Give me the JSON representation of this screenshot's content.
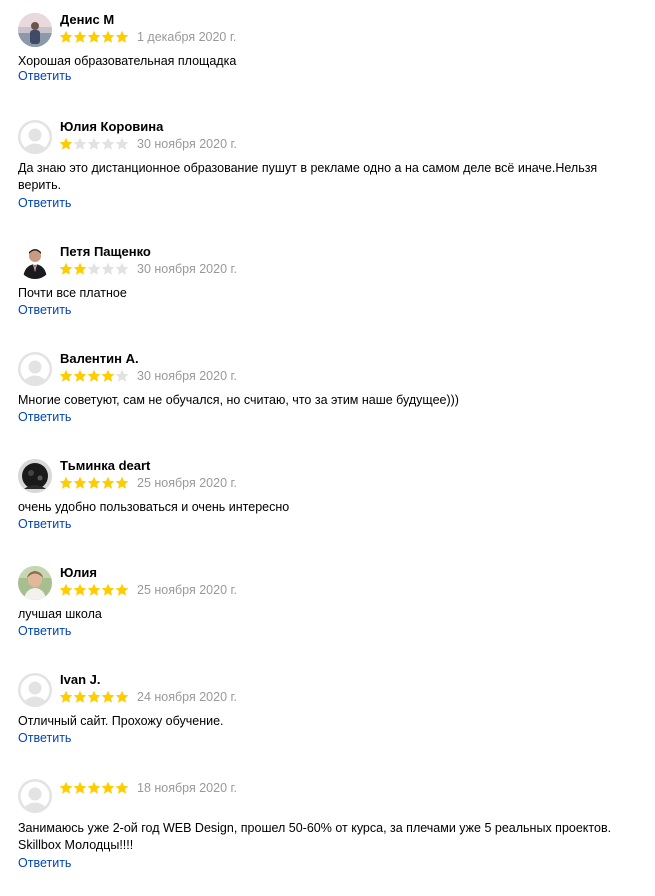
{
  "reply_label": "Ответить",
  "colors": {
    "star_filled": "#ffcc00",
    "star_empty": "#e2e2e2",
    "link": "#0044bb",
    "date": "#999999"
  },
  "reviews": [
    {
      "author": "Денис М",
      "rating": 5,
      "date": "1 декабря 2020 г.",
      "text": "Хорошая образовательная площадка",
      "avatar": "photo-person-outdoors"
    },
    {
      "author": "Юлия Коровина",
      "rating": 1,
      "date": "30 ноября 2020 г.",
      "text": "Да знаю это дистанционное образование пушут в рекламе одно а на самом деле всё иначе.Нельзя верить.",
      "avatar": "default-user-icon"
    },
    {
      "author": "Петя Пащенко",
      "rating": 2,
      "date": "30 ноября 2020 г.",
      "text": "Почти все платное",
      "avatar": "photo-person-suit"
    },
    {
      "author": "Валентин А.",
      "rating": 4,
      "date": "30 ноября 2020 г.",
      "text": "Многие советуют, сам не обучался, но считаю, что за этим наше будущее)))",
      "avatar": "default-user-icon"
    },
    {
      "author": "Тьминка deart",
      "rating": 5,
      "date": "25 ноября 2020 г.",
      "text": "очень удобно пользоваться и очень интересно",
      "avatar": "photo-dark"
    },
    {
      "author": "Юлия",
      "rating": 5,
      "date": "25 ноября 2020 г.",
      "text": "лучшая школа",
      "avatar": "photo-person-green"
    },
    {
      "author": "Ivan J.",
      "rating": 5,
      "date": "24 ноября 2020 г.",
      "text": "Отличный сайт. Прохожу обучение.",
      "avatar": "default-user-icon"
    },
    {
      "author": "",
      "rating": 5,
      "date": "18 ноября 2020 г.",
      "text": "Занимаюсь уже 2-ой год WEB Design, прошел 50-60% от курса, за плечами уже 5 реальных проектов. Skillbox Молодцы!!!!",
      "avatar": "default-user-icon"
    }
  ]
}
